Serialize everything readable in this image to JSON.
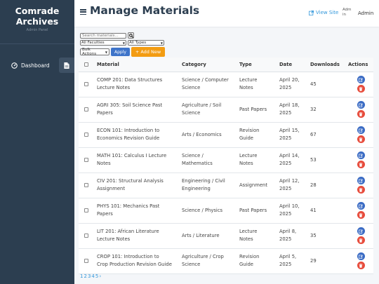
{
  "sidebar": {
    "brand_title_line1": "Comrade",
    "brand_title_line2": "Archives",
    "brand_subtitle": "Admin Panel",
    "nav": [
      {
        "label": "Dashboard",
        "icon": "dashboard-icon"
      },
      {
        "label": "",
        "icon": "file-icon"
      }
    ]
  },
  "header": {
    "title": "Manage Materials",
    "view_site": "View Site",
    "avatar_alt_line1": "Adm",
    "avatar_alt_line2": "in",
    "user": "Admin"
  },
  "filters": {
    "search_placeholder": "Search materials...",
    "faculty": "All Faculties",
    "type": "All Types",
    "bulk": "Bulk Actions",
    "apply": "Apply",
    "add_new": "+ Add New"
  },
  "table": {
    "headers": [
      "Material",
      "Category",
      "Type",
      "Date",
      "Downloads",
      "Actions"
    ],
    "rows": [
      {
        "material": [
          "COMP 201: Data Structures",
          "Lecture Notes"
        ],
        "category": [
          "Science / Computer",
          "Science"
        ],
        "type": [
          "Lecture",
          "Notes"
        ],
        "date": [
          "April 20,",
          "2025"
        ],
        "downloads": "45"
      },
      {
        "material": [
          "AGRI 305: Soil Science Past",
          "Papers"
        ],
        "category": [
          "Agriculture / Soil",
          "Science"
        ],
        "type": [
          "Past Papers",
          ""
        ],
        "date": [
          "April 18,",
          "2025"
        ],
        "downloads": "32"
      },
      {
        "material": [
          "ECON 101: Introduction to",
          "Economics Revision Guide"
        ],
        "category": [
          "Arts / Economics",
          ""
        ],
        "type": [
          "Revision",
          "Guide"
        ],
        "date": [
          "April 15,",
          "2025"
        ],
        "downloads": "67"
      },
      {
        "material": [
          "MATH 101: Calculus I Lecture",
          "Notes"
        ],
        "category": [
          "Science /",
          "Mathematics"
        ],
        "type": [
          "Lecture",
          "Notes"
        ],
        "date": [
          "April 14,",
          "2025"
        ],
        "downloads": "53"
      },
      {
        "material": [
          "CIV 201: Structural Analysis",
          "Assignment"
        ],
        "category": [
          "Engineering / Civil",
          "Engineering"
        ],
        "type": [
          "Assignment",
          ""
        ],
        "date": [
          "April 12,",
          "2025"
        ],
        "downloads": "28"
      },
      {
        "material": [
          "PHYS 101: Mechanics Past",
          "Papers"
        ],
        "category": [
          "Science / Physics",
          ""
        ],
        "type": [
          "Past Papers",
          ""
        ],
        "date": [
          "April 10,",
          "2025"
        ],
        "downloads": "41"
      },
      {
        "material": [
          "LIT 201: African Literature",
          "Lecture Notes"
        ],
        "category": [
          "Arts / Literature",
          ""
        ],
        "type": [
          "Lecture",
          "Notes"
        ],
        "date": [
          "April 8,",
          "2025"
        ],
        "downloads": "35"
      },
      {
        "material": [
          "CROP 101: Introduction to",
          "Crop Production Revision Guide"
        ],
        "category": [
          "Agriculture / Crop",
          "Science"
        ],
        "type": [
          "Revision",
          "Guide"
        ],
        "date": [
          "April 5,",
          "2025"
        ],
        "downloads": "29"
      }
    ]
  },
  "pagination": [
    "1",
    "2",
    "3",
    "4",
    "5",
    "›"
  ],
  "colors": {
    "sidebar": "#2c3e50",
    "accent": "#3498db",
    "apply": "#3e74c9",
    "add": "#f39c12",
    "delete": "#e74c3c"
  }
}
